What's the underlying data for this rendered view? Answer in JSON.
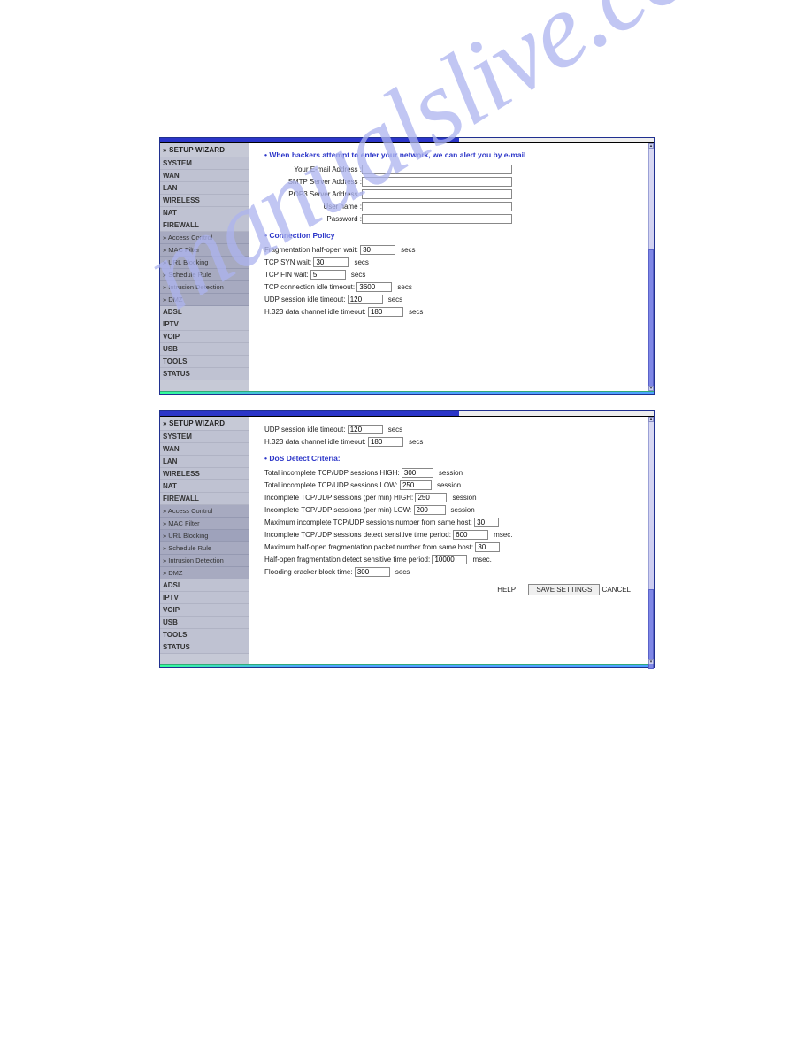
{
  "watermark": "manualslive.com",
  "nav": {
    "wizard": "» SETUP WIZARD",
    "items_top": [
      "SYSTEM",
      "WAN",
      "LAN",
      "WIRELESS",
      "NAT",
      "FIREWALL"
    ],
    "subs": [
      "» Access Control",
      "» MAC Filter",
      "» URL Blocking",
      "» Schedule Rule",
      "» Intrusion Detection",
      "» DMZ"
    ],
    "items_bottom": [
      "ADSL",
      "IPTV",
      "VOIP",
      "USB",
      "TOOLS",
      "STATUS"
    ]
  },
  "panel1": {
    "title": "When hackers attempt to enter your network, we can alert you by e-mail",
    "email_label": "Your E-mail Address :",
    "smtp_label": "SMTP Server Address :",
    "pop3_label": "POP3 Server Address :",
    "user_label": "User name :",
    "pass_label": "Password :",
    "policy_title": "Connection Policy",
    "frag_label": "Fragmentation half-open wait:",
    "frag_val": "30",
    "syn_label": "TCP SYN wait:",
    "syn_val": "30",
    "fin_label": "TCP FIN wait:",
    "fin_val": "5",
    "tcpidle_label": "TCP connection idle timeout:",
    "tcpidle_val": "3600",
    "udp_label": "UDP session idle timeout:",
    "udp_val": "120",
    "h323_label": "H.323 data channel idle timeout:",
    "h323_val": "180",
    "secs": "secs"
  },
  "panel2": {
    "udp_label": "UDP session idle timeout:",
    "udp_val": "120",
    "h323_label": "H.323 data channel idle timeout:",
    "h323_val": "180",
    "dos_title": "DoS Detect Criteria:",
    "ti_high_label": "Total incomplete TCP/UDP sessions HIGH:",
    "ti_high_val": "300",
    "ti_low_label": "Total incomplete TCP/UDP sessions LOW:",
    "ti_low_val": "250",
    "inc_high_label": "Incomplete TCP/UDP sessions (per min) HIGH:",
    "inc_high_val": "250",
    "inc_low_label": "Incomplete TCP/UDP sessions (per min) LOW:",
    "inc_low_val": "200",
    "max_inc_label": "Maximum incomplete TCP/UDP sessions number from same host:",
    "max_inc_val": "30",
    "inc_time_label": "Incomplete TCP/UDP sessions detect sensitive time period:",
    "inc_time_val": "600",
    "max_frag_label": "Maximum half-open fragmentation packet number from same host:",
    "max_frag_val": "30",
    "frag_time_label": "Half-open fragmentation detect sensitive time period:",
    "frag_time_val": "10000",
    "flood_label": "Flooding cracker block time:",
    "flood_val": "300",
    "session": "session",
    "msec": "msec.",
    "secs": "secs",
    "help": "HELP",
    "save": "SAVE SETTINGS",
    "cancel": "CANCEL"
  }
}
